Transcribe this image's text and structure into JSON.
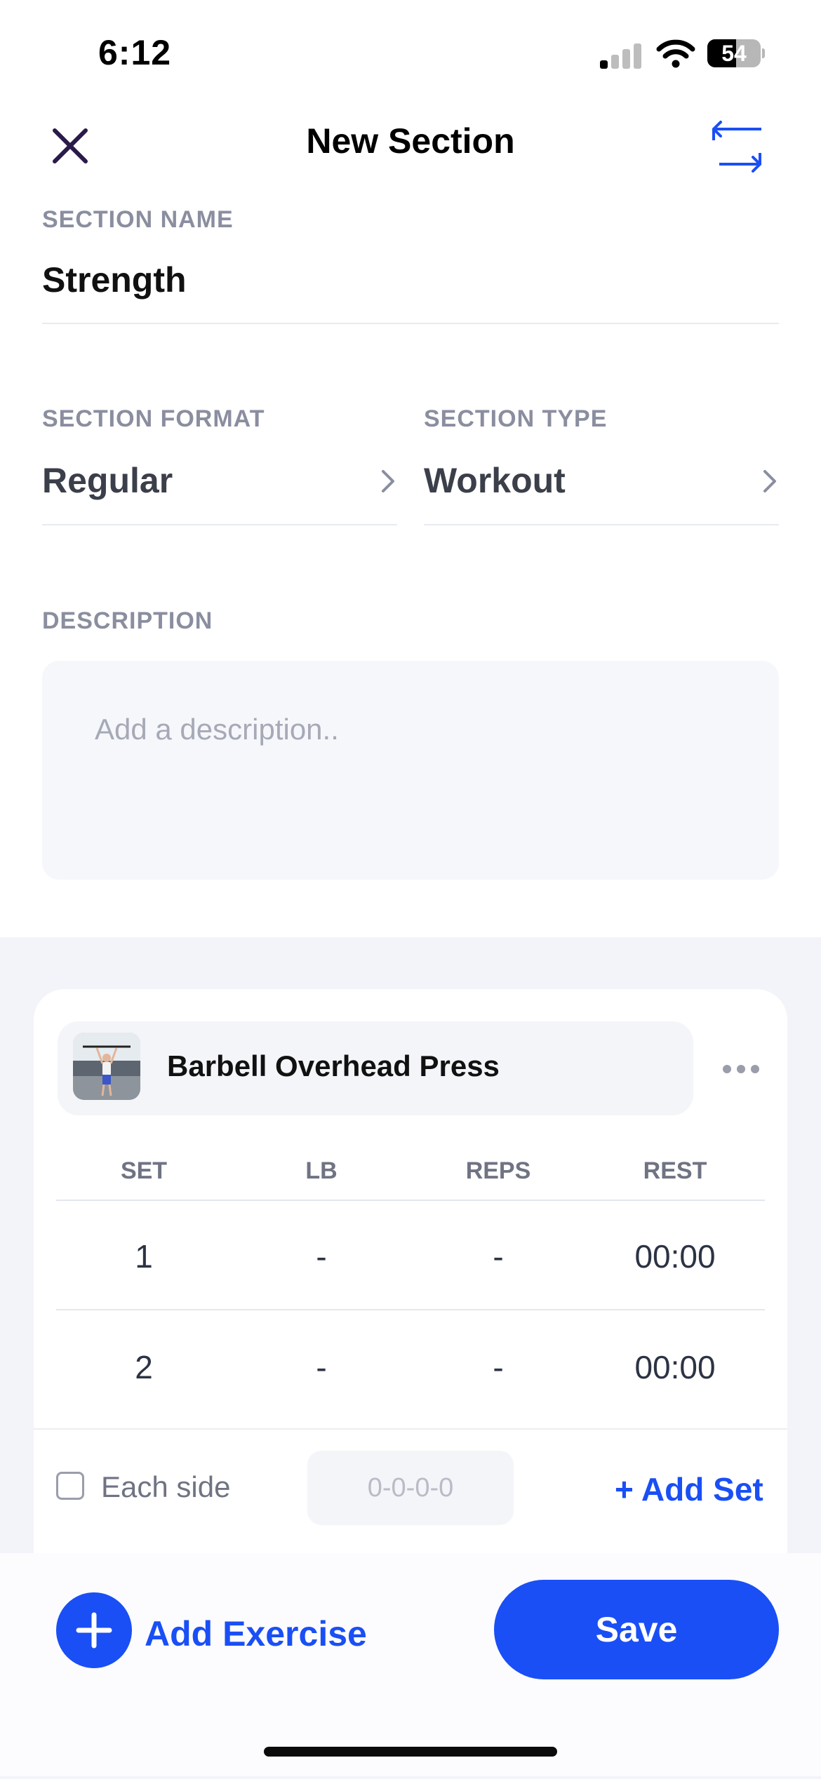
{
  "status_bar": {
    "time": "6:12",
    "battery": "54",
    "battery_level": 0.54
  },
  "header": {
    "title": "New Section"
  },
  "section_name": {
    "label": "SECTION NAME",
    "value": "Strength"
  },
  "section_format": {
    "label": "SECTION FORMAT",
    "value": "Regular"
  },
  "section_type": {
    "label": "SECTION TYPE",
    "value": "Workout"
  },
  "description": {
    "label": "DESCRIPTION",
    "placeholder": "Add a description.."
  },
  "exercise": {
    "name": "Barbell Overhead Press",
    "columns": [
      "SET",
      "LB",
      "REPS",
      "REST"
    ],
    "rows": [
      {
        "set": "1",
        "lb": "-",
        "reps": "-",
        "rest": "00:00"
      },
      {
        "set": "2",
        "lb": "-",
        "reps": "-",
        "rest": "00:00"
      }
    ],
    "each_side_label": "Each side",
    "tempo_placeholder": "0-0-0-0",
    "add_set_label": "+ Add Set"
  },
  "footer": {
    "add_exercise_label": "Add Exercise",
    "save_label": "Save"
  },
  "colors": {
    "accent": "#1a4ff5",
    "close_icon": "#2a1a4a"
  }
}
